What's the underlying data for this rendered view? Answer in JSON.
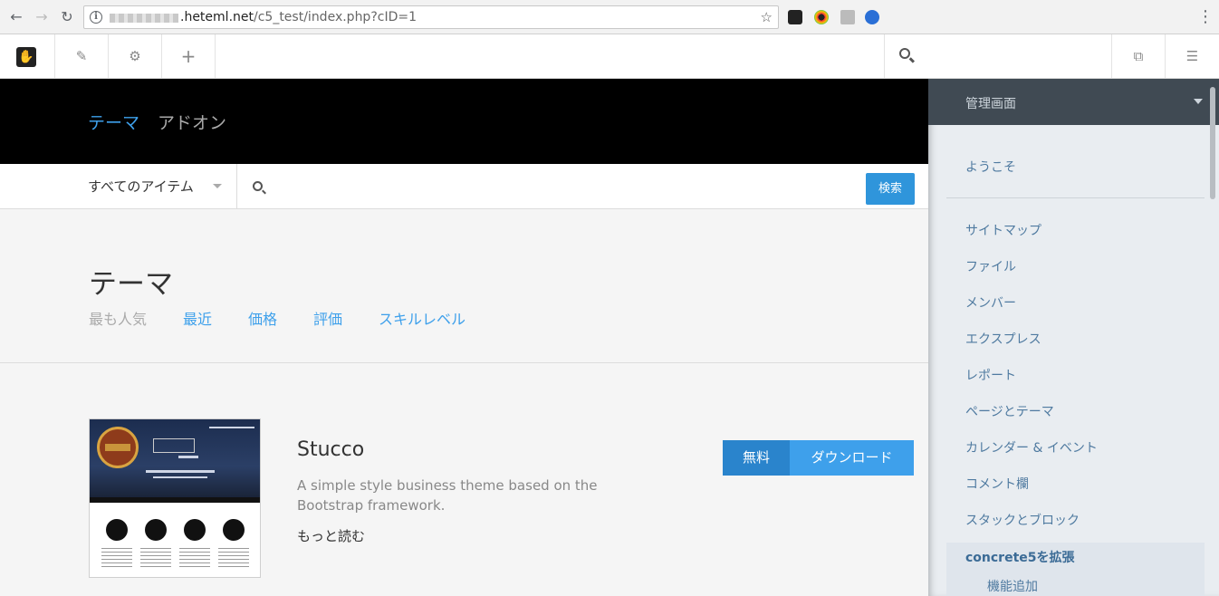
{
  "browser": {
    "back_glyph": "←",
    "forward_glyph": "→",
    "reload_glyph": "↻",
    "url_domain": ".heteml.net",
    "url_path": "/c5_test/index.php?cID=1",
    "star_glyph": "☆",
    "extensions": [
      "concrete5-icon",
      "color-picker-icon",
      "camera-icon",
      "profile-icon"
    ],
    "menu_glyph": "⋮"
  },
  "toolbar": {
    "logo_glyph": "✋",
    "edit_glyph": "✎",
    "settings_glyph": "⚙",
    "add_glyph": "+",
    "pages_glyph": "⧉",
    "panel_glyph": "☰"
  },
  "hero": {
    "tabs": [
      {
        "label": "テーマ",
        "active": true
      },
      {
        "label": "アドオン",
        "active": false
      }
    ]
  },
  "filter": {
    "select_value": "すべてのアイテム",
    "search_button": "検索"
  },
  "section": {
    "title": "テーマ",
    "sort_options": [
      {
        "label": "最も人気",
        "active": true
      },
      {
        "label": "最近",
        "active": false
      },
      {
        "label": "価格",
        "active": false
      },
      {
        "label": "評価",
        "active": false
      },
      {
        "label": "スキルレベル",
        "active": false
      }
    ]
  },
  "item": {
    "title": "Stucco",
    "description": "A simple style business theme based on the Bootstrap framework.",
    "more_link": "もっと読む",
    "price_label": "無料",
    "download_label": "ダウンロード"
  },
  "sidebar": {
    "header": "管理画面",
    "welcome": "ようこそ",
    "items": [
      "サイトマップ",
      "ファイル",
      "メンバー",
      "エクスプレス",
      "レポート",
      "ページとテーマ",
      "カレンダー & イベント",
      "コメント欄",
      "スタックとブロック"
    ],
    "active_section": "concrete5を拡張",
    "active_sub": "機能追加"
  },
  "colors": {
    "accent": "#2f95db",
    "hero_bg": "#000000",
    "sidebar_head": "#404a53",
    "sidebar_link": "#4f7aa0"
  }
}
